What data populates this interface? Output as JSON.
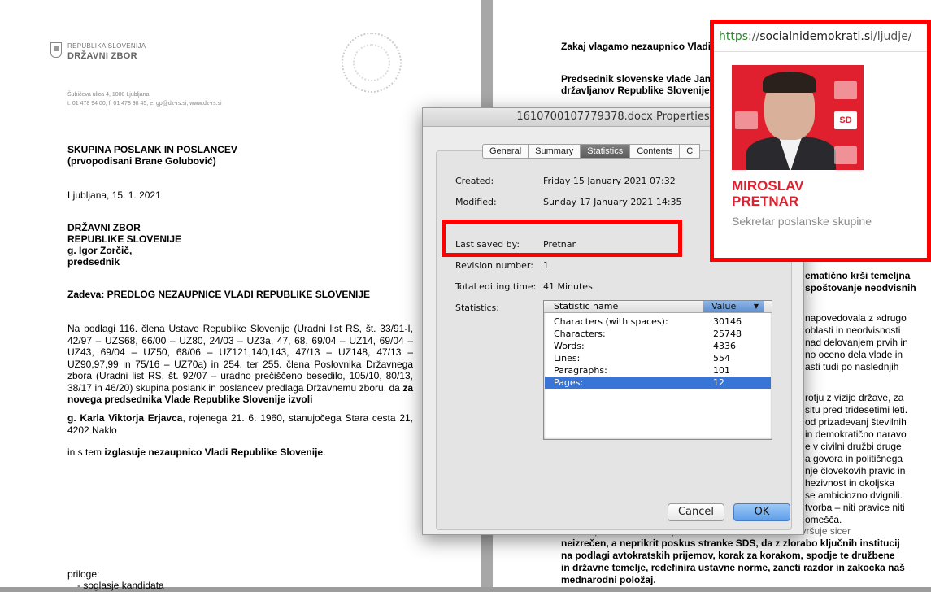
{
  "left_page": {
    "header_small": "REPUBLIKA SLOVENIJA",
    "header_big": "DRŽAVNI ZBOR",
    "address_1": "Šubičeva ulica 4, 1000 Ljubljana",
    "address_2": "t: 01 478 94 00, f: 01 478 98 45, e: gp@dz-rs.si, www.dz-rs.si",
    "group_1": "SKUPINA POSLANK IN POSLANCEV",
    "group_2": "(prvopodisani Brane Golubović)",
    "date_line": "Ljubljana, 15. 1. 2021",
    "recipient": [
      "DRŽAVNI ZBOR",
      "REPUBLIKE SLOVENIJE",
      "g. Igor Zorčič,",
      "predsednik"
    ],
    "subject": "Zadeva: PREDLOG NEZAUPNICE VLADI REPUBLIKE SLOVENIJE",
    "para_1": "Na podlagi 116. člena Ustave Republike Slovenije (Uradni list RS, št. 33/91-I, 42/97 – UZS68, 66/00 – UZ80, 24/03 – UZ3a, 47, 68, 69/04 – UZ14, 69/04 – UZ43, 69/04 – UZ50, 68/06 – UZ121,140,143, 47/13 – UZ148, 47/13 – UZ90,97,99 in 75/16 – UZ70a) in 254. ter 255. člena Poslovnika Državnega zbora (Uradni list RS, št. 92/07 – uradno prečiščeno besedilo, 105/10, 80/13, 38/17 in 46/20) skupina poslank in poslancev predlaga Državnemu zboru, da",
    "para_1_bold": "za novega predsednika Vlade Republike Slovenije izvoli",
    "candidate_bold": "g. Karla Viktorja Erjavca",
    "candidate_rest": ", rojenega 21. 6. 1960, stanujočega Stara cesta 21, 4202 Naklo",
    "closing_plain": "in s tem",
    "closing_bold": "izglasuje nezaupnico Vladi Republike Slovenije",
    "closing_end": ".",
    "attachments": "priloge:",
    "attachment_1": "-     soglasje kandidata"
  },
  "right_page": {
    "heading": "Zakaj vlagamo nezaupnico Vladi",
    "intro_1": "Predsednik slovenske vlade Jan",
    "intro_2": "državljanov Republike Slovenije",
    "frag_bold_1": "ematično krši temeljna",
    "frag_bold_2": "spoštovanje neodvisnih",
    "frag_b": [
      "napovedovala z »drugo",
      "oblasti in neodvisnosti",
      "nad delovanjem prvih in",
      "no oceno dela vlade in",
      "asti tudi po naslednjih"
    ],
    "frag_c": [
      "rotju z vizijo države, za",
      "situ pred tridesetimi leti.",
      "od prizadevanj številnih",
      "in demokratično naravo",
      "e v civilni družbi druge",
      "a govora in političnega",
      "nje človekovih pravic in",
      "hezivnost in okoljska",
      "se ambiciozno dvignili.",
      "tvorba – niti pravice niti",
      "omešča."
    ],
    "bottom_1": "Vendar pa vlada točno to počne. Pred našimi očmi se izvršuje sicer",
    "bottom_2": "neizrečen, a neprikrit poskus stranke SDS, da z zlorabo ključnih institucij",
    "bottom_3": "na podlagi avtokratskih prijemov, korak za korakom, spodje te družbene",
    "bottom_4": "in državne temelje, redefinira ustavne norme, zaneti razdor in zakocka naš",
    "bottom_5": "mednarodni položaj."
  },
  "dialog": {
    "title": "1610700107779378.docx Properties",
    "tabs": [
      "General",
      "Summary",
      "Statistics",
      "Contents",
      "C"
    ],
    "active_tab": "Statistics",
    "created_label": "Created:",
    "created_value": "Friday 15 January 2021 07:32",
    "modified_label": "Modified:",
    "modified_value": "Sunday 17 January 2021 14:35",
    "last_saved_label": "Last saved by:",
    "last_saved_value": "Pretnar",
    "revision_label": "Revision number:",
    "revision_value": "1",
    "editing_label": "Total editing time:",
    "editing_value": "41 Minutes",
    "statistics_label": "Statistics:",
    "table_headers": [
      "Statistic name",
      "Value"
    ],
    "rows": [
      {
        "name": "Characters (with spaces):",
        "value": "30146"
      },
      {
        "name": "Characters:",
        "value": "25748"
      },
      {
        "name": "Words:",
        "value": "4336"
      },
      {
        "name": "Lines:",
        "value": "554"
      },
      {
        "name": "Paragraphs:",
        "value": "101"
      },
      {
        "name": "Pages:",
        "value": "12"
      }
    ],
    "selected_row": "Pages:",
    "cancel_label": "Cancel",
    "ok_label": "OK"
  },
  "profile_card": {
    "url_scheme": "https",
    "url_sep": "://",
    "url_domain": "socialnidemokrati.si",
    "url_path": "/ljudje/",
    "sd_logo": "SD",
    "name_line_1": "MIROSLAV",
    "name_line_2": "PRETNAR",
    "role": "Sekretar poslanske skupine"
  },
  "colors": {
    "highlight_red": "#ff0000",
    "sd_red": "#e0202e",
    "selection_blue": "#3875d7"
  }
}
